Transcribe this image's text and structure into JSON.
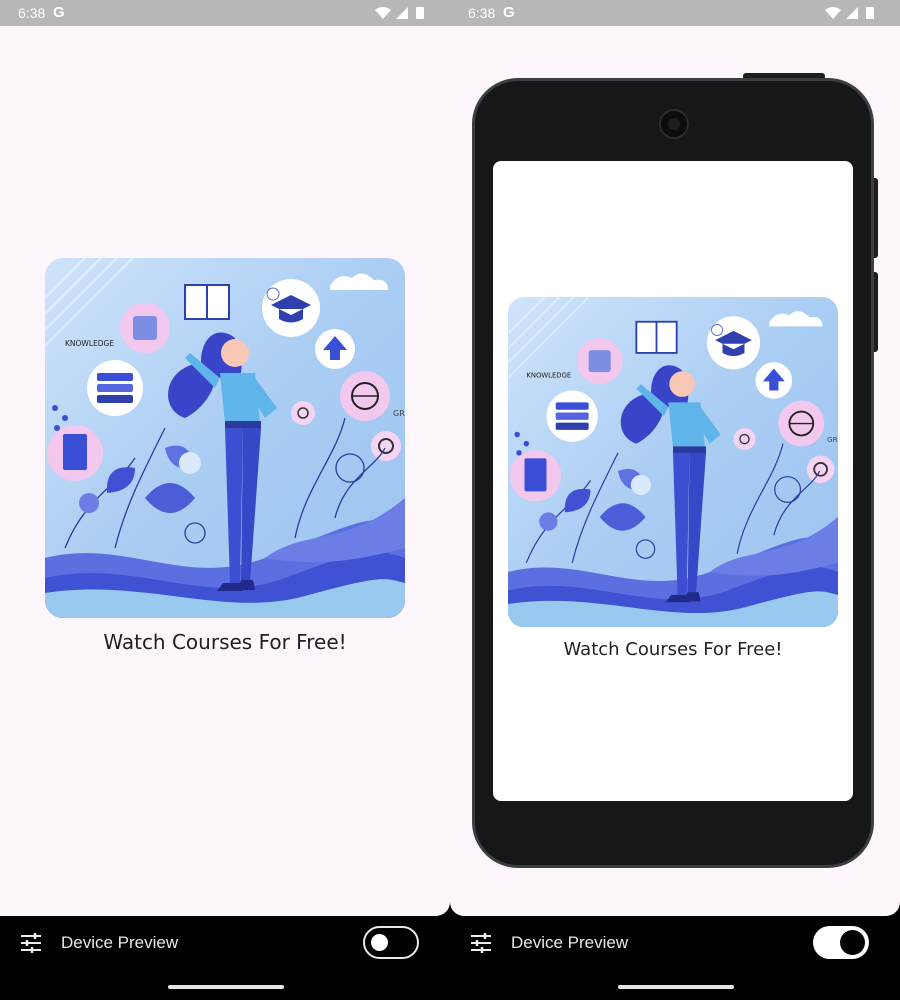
{
  "status": {
    "time": "6:38",
    "google": "G"
  },
  "app": {
    "caption": "Watch Courses For Free!"
  },
  "illustration": {
    "label_knowledge": "KNOWLEDGE",
    "label_gr": "GR"
  },
  "toolbar": {
    "label": "Device Preview",
    "left_toggle": "off",
    "right_toggle": "on"
  },
  "colors": {
    "surface": "#fdf7fd",
    "accent_blue": "#3a4fd6",
    "light_blue": "#a9d0f3",
    "pink": "#f2c8ee"
  }
}
